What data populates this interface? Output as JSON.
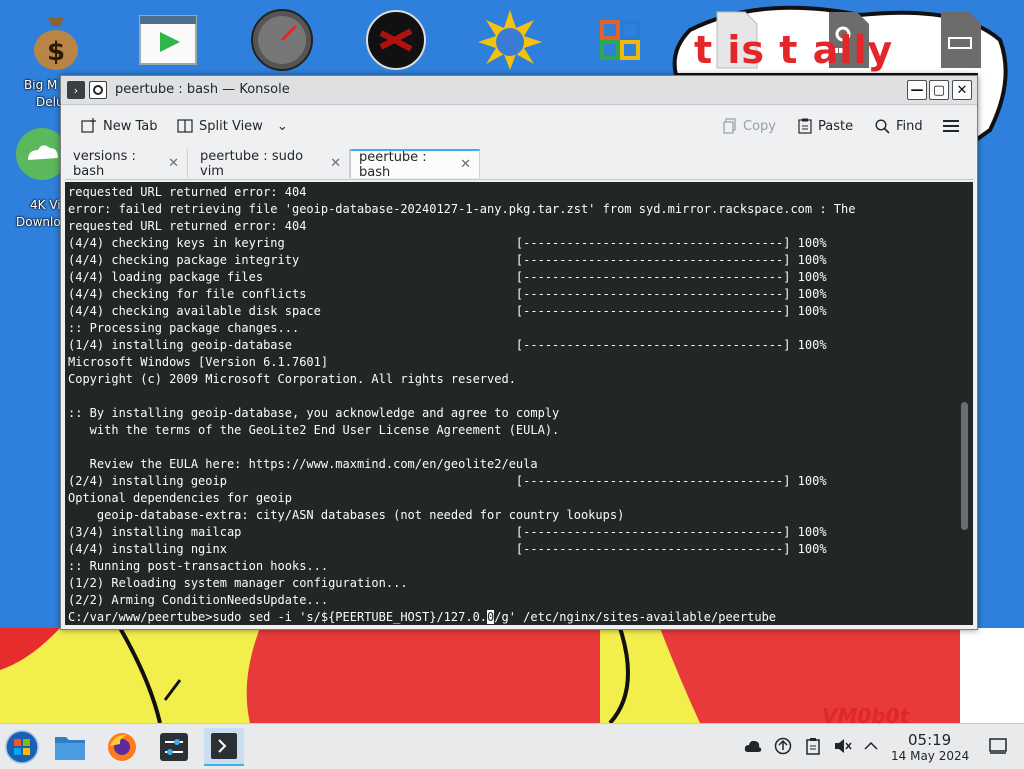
{
  "desktop": {
    "labels": {
      "big_money": "Big M",
      "big_money2": "Delu",
      "four_k": "4K Vi",
      "four_k2": "Downlo"
    },
    "wallpaper_text": "t  is t  ally",
    "watermark": "VM0b0t"
  },
  "window": {
    "title": "peertube : bash — Konsole",
    "controls": {
      "minimize": "—",
      "maximize": "▢",
      "close": "✕"
    }
  },
  "toolbar": {
    "new_tab": "New Tab",
    "split_view": "Split View",
    "copy": "Copy",
    "paste": "Paste",
    "find": "Find"
  },
  "tabs": [
    {
      "label": "versions : bash",
      "active": false
    },
    {
      "label": "peertube : sudo vim",
      "active": false
    },
    {
      "label": "peertube : bash",
      "active": true
    }
  ],
  "terminal": {
    "lines": [
      "requested URL returned error: 404",
      "error: failed retrieving file 'geoip-database-20240127-1-any.pkg.tar.zst' from syd.mirror.rackspace.com : The",
      "requested URL returned error: 404",
      "(4/4) checking keys in keyring                                [------------------------------------] 100%",
      "(4/4) checking package integrity                              [------------------------------------] 100%",
      "(4/4) loading package files                                   [------------------------------------] 100%",
      "(4/4) checking for file conflicts                             [------------------------------------] 100%",
      "(4/4) checking available disk space                           [------------------------------------] 100%",
      ":: Processing package changes...",
      "(1/4) installing geoip-database                               [------------------------------------] 100%",
      "Microsoft Windows [Version 6.1.7601]",
      "Copyright (c) 2009 Microsoft Corporation. All rights reserved.",
      "",
      ":: By installing geoip-database, you acknowledge and agree to comply",
      "   with the terms of the GeoLite2 End User License Agreement (EULA).",
      "",
      "   Review the EULA here: https://www.maxmind.com/en/geolite2/eula",
      "(2/4) installing geoip                                        [------------------------------------] 100%",
      "Optional dependencies for geoip",
      "    geoip-database-extra: city/ASN databases (not needed for country lookups)",
      "(3/4) installing mailcap                                      [------------------------------------] 100%",
      "(4/4) installing nginx                                        [------------------------------------] 100%",
      ":: Running post-transaction hooks...",
      "(1/2) Reloading system manager configuration...",
      "(2/2) Arming ConditionNeedsUpdate..."
    ],
    "prompt_before_cursor": "C:/var/www/peertube>sudo sed -i 's/${PEERTUBE_HOST}/127.0.",
    "prompt_cursor_char": "0",
    "prompt_after_cursor": "/g' /etc/nginx/sites-available/peertube",
    "scroll_position": 0.7
  },
  "taskbar": {
    "time": "05:19",
    "date": "14 May 2024"
  },
  "colors": {
    "accent": "#3daee9",
    "terminal_bg": "#232627",
    "terminal_fg": "#fcfcfc"
  }
}
